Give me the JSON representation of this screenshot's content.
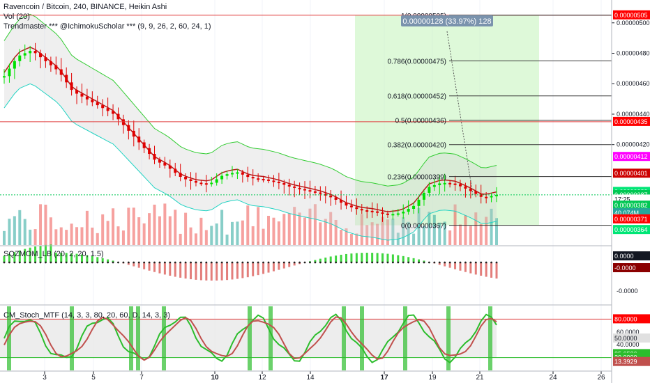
{
  "legend": {
    "title": "Ravencoin / Bitcoin, 240, BINANCE, Heikin Ashi",
    "vol": "Vol (20)",
    "indicator": "Trendmaster *** @IchimokuScholar *** (9, 9, 26, 2, 60, 24, 1)"
  },
  "panes": {
    "sqz_label": "SQZMOM_LB (20, 2, 20, 1.5)",
    "stoch_label": "CM_Stoch_MTF (14, 3, 3, 80, 20, 60, D, 14, 3, 3)"
  },
  "measure_label": "0.00000128 (33.97%) 128",
  "colors": {
    "up": "#26a69a",
    "down": "#ef5350",
    "bull_candle": "#00e000",
    "bear_candle": "#e00000",
    "long_zone": "#c8f5c0",
    "hline": "#e04040",
    "fib": "#333333",
    "stoch_k": "#2cbd2c",
    "stoch_d": "#c0504d"
  },
  "chart_data": {
    "type": "candlestick",
    "ylim": [
      3.54e-06,
      5.15e-06
    ],
    "x_ticks": [
      "3",
      "5",
      "7",
      "10",
      "12",
      "14",
      "17",
      "19",
      "21",
      "24",
      "26"
    ],
    "price_axis_ticks": [
      "0.00000500",
      "0.00000480",
      "0.00000460",
      "0.00000440",
      "0.00000420"
    ],
    "price_tags": [
      {
        "label": "0.00000505",
        "value": 5.05e-06,
        "color": "#ff0000"
      },
      {
        "label": "0.00000435",
        "value": 4.35e-06,
        "color": "#ff0000"
      },
      {
        "label": "0.00000412",
        "value": 4.12e-06,
        "color": "#ff00ff"
      },
      {
        "label": "0.00000401",
        "value": 4.01e-06,
        "color": "#cc0000"
      },
      {
        "label": "0.00000389",
        "value": 3.89e-06,
        "color": "#00e676"
      },
      {
        "label": "0.00000387",
        "value": 3.87e-06,
        "color": "#00c853"
      },
      {
        "label": "17:25",
        "value": 3.84e-06,
        "color": "#ffffff"
      },
      {
        "label": "0.00000382",
        "value": 3.8e-06,
        "color": "#00c853"
      },
      {
        "label": "40.074M",
        "value": 3.75e-06,
        "color": "#26a69a"
      },
      {
        "label": "0.00000371",
        "value": 3.71e-06,
        "color": "#ff0000"
      },
      {
        "label": "0.00000364",
        "value": 3.64e-06,
        "color": "#00e676"
      }
    ],
    "fib_levels": [
      {
        "label": "1(0.00000505)",
        "value": 5.05e-06
      },
      {
        "label": "0.786(0.00000475)",
        "value": 4.75e-06
      },
      {
        "label": "0.618(0.00000452)",
        "value": 4.52e-06
      },
      {
        "label": "0.5(0.00000436)",
        "value": 4.36e-06
      },
      {
        "label": "0.382(0.00000420)",
        "value": 4.2e-06
      },
      {
        "label": "0.236(0.00000399)",
        "value": 3.99e-06
      },
      {
        "label": "0(0.00000367)",
        "value": 3.67e-06
      }
    ],
    "close_approx": [
      0.000465,
      0.000478,
      0.000482,
      0.000475,
      0.000468,
      0.000455,
      0.00045,
      0.000445,
      0.00044,
      0.00043,
      0.00042,
      0.00041,
      0.000405,
      0.000398,
      0.000395,
      0.000394,
      0.0004,
      0.000402,
      0.000398,
      0.000397,
      0.000395,
      0.000392,
      0.00039,
      0.000388,
      0.000385,
      0.00038,
      0.000377,
      0.000376,
      0.000374,
      0.000375,
      0.00038,
      0.000392,
      0.000395,
      0.000394,
      0.00039,
      0.000385,
      0.000387
    ],
    "sqz_axis_ticks": [
      "0.0000",
      "-0.0000",
      "-0.0000"
    ],
    "stoch_axis_ticks": [
      "80.0000",
      "60.0000",
      "50.0000",
      "40.0000",
      "25.6536",
      "20.0000",
      "13.3929"
    ]
  }
}
